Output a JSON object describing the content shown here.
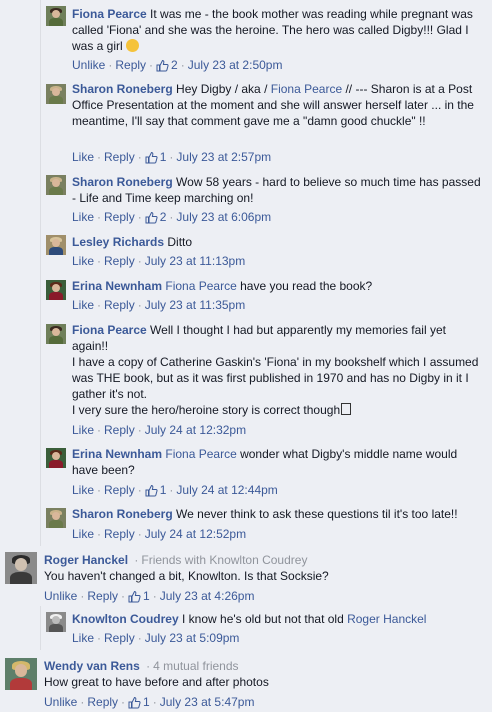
{
  "labels": {
    "like": "Like",
    "unlike": "Unlike",
    "reply": "Reply",
    "dot": "·"
  },
  "comments": [
    {
      "author": "Fiona Pearce",
      "text": "It was me - the book mother was reading while pregnant was called 'Fiona' and she was the heroine. The hero was called Digby!!! Glad I was a girl",
      "liked": true,
      "likes": "2",
      "time": "July 23 at 2:50pm"
    },
    {
      "author": "Sharon Roneberg",
      "text_a": "Hey Digby / aka /",
      "mention": "Fiona Pearce",
      "text_b": "// --- Sharon is at a Post Office Presentation at the moment and she will answer herself later ... in the meantime, I'll say that comment gave me a \"damn good chuckle\" !!",
      "liked": false,
      "likes": "1",
      "time": "July 23 at 2:57pm"
    },
    {
      "author": "Sharon Roneberg",
      "text": "Wow 58 years - hard to believe so much time has passed - Life and Time keep marching on!",
      "liked": false,
      "likes": "2",
      "time": "July 23 at 6:06pm"
    },
    {
      "author": "Lesley Richards",
      "text": "Ditto",
      "liked": false,
      "time": "July 23 at 11:13pm"
    },
    {
      "author": "Erina Newnham",
      "mention": "Fiona Pearce",
      "text": "have you read the book?",
      "liked": false,
      "time": "July 23 at 11:35pm"
    },
    {
      "author": "Fiona Pearce",
      "lines": [
        "Well I thought I had but apparently my memories fail yet again!!",
        "I have a copy of Catherine Gaskin's 'Fiona' in my bookshelf which I assumed was THE book, but as it was first published in 1970 and has no Digby in it I gather it's not.",
        "I very sure the hero/heroine story is correct though"
      ],
      "liked": false,
      "time": "July 24 at 12:32pm"
    },
    {
      "author": "Erina Newnham",
      "mention": "Fiona Pearce",
      "text": "wonder what Digby's middle name would have been?",
      "liked": false,
      "likes": "1",
      "time": "July 24 at 12:44pm"
    },
    {
      "author": "Sharon Roneberg",
      "text": "We never think to ask these questions til it's too late!!",
      "liked": false,
      "time": "July 24 at 12:52pm"
    },
    {
      "author": "Roger Hanckel",
      "friends": "Friends with Knowlton Coudrey",
      "text": "You haven't changed a bit, Knowlton. Is that Socksie?",
      "liked": true,
      "likes": "1",
      "time": "July 23 at 4:26pm"
    },
    {
      "author": "Knowlton Coudrey",
      "text": "I know he's old but not that old",
      "mention": "Roger Hanckel",
      "liked": false,
      "time": "July 23 at 5:09pm"
    },
    {
      "author": "Wendy van Rens",
      "friends": "4 mutual friends",
      "text": "How great to have before and after photos",
      "liked": true,
      "likes": "1",
      "time": "July 23 at 5:47pm"
    }
  ]
}
